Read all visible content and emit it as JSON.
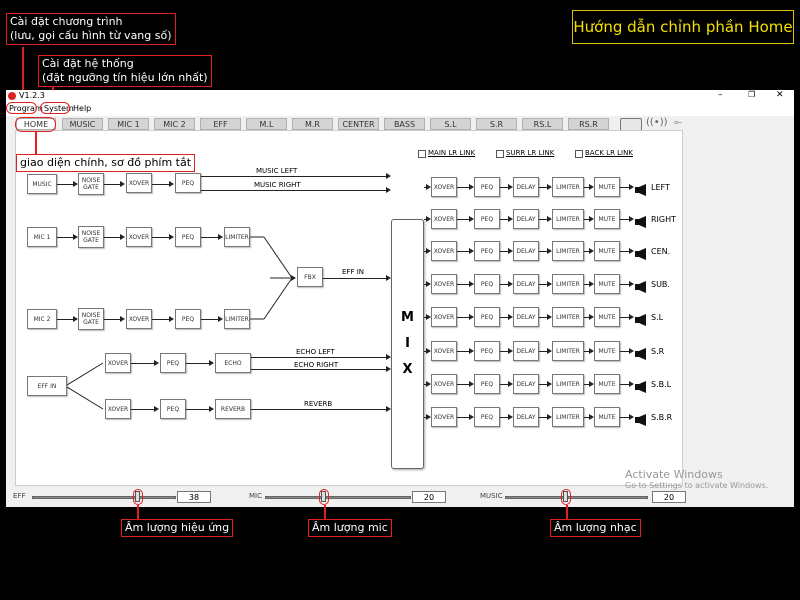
{
  "guide_title": "Hướng dẫn chỉnh phần Home",
  "annotations": {
    "program": [
      "Cài đặt chương trình",
      "(lưu, gọi cấu hình từ vang số)"
    ],
    "system": [
      "Cài đặt hệ thống",
      "(đặt ngưỡng tín hiệu lớn nhất)"
    ],
    "home": "giao diện chính, sơ đồ phím tắt",
    "eff_volume": "Âm lượng hiệu ứng",
    "mic_volume": "Âm lượng mic",
    "music_volume": "Âm lượng nhạc"
  },
  "window": {
    "version": "V1.2.3",
    "controls": [
      "–",
      "❐",
      "✕"
    ]
  },
  "menu": {
    "program": "Program",
    "system": "System",
    "help": "Help"
  },
  "tabs": [
    "HOME",
    "MUSIC",
    "MIC 1",
    "MIC 2",
    "EFF",
    "M.L",
    "M.R",
    "CENTER",
    "BASS",
    "S.L",
    "S.R",
    "RS.L",
    "RS.R"
  ],
  "links": {
    "main": "MAIN LR LINK",
    "surr": "SURR LR LINK",
    "back": "BACK LR LINK"
  },
  "inputs": {
    "music": {
      "source": "MUSIC",
      "chain": [
        "NOISE GATE",
        "XOVER",
        "PEQ"
      ],
      "out1": "MUSIC LEFT",
      "out2": "MUSIC RIGHT"
    },
    "mic1": {
      "source": "MIC 1",
      "chain": [
        "NOISE GATE",
        "XOVER",
        "PEQ",
        "LIMITER"
      ]
    },
    "mic2": {
      "source": "MIC 2",
      "chain": [
        "NOISE GATE",
        "XOVER",
        "PEQ",
        "LIMITER"
      ]
    },
    "fbx": "FBX",
    "eff_in_label": "EFF IN",
    "eff": {
      "source": "EFF IN",
      "chain1": [
        "XOVER",
        "PEQ",
        "ECHO"
      ],
      "chain2": [
        "XOVER",
        "PEQ",
        "REVERB"
      ],
      "out1": "ECHO LEFT",
      "out2": "ECHO RIGHT",
      "out3": "REVERB"
    }
  },
  "mix": [
    "M",
    "I",
    "X"
  ],
  "output_chain": [
    "XOVER",
    "PEQ",
    "DELAY",
    "LIMITER",
    "MUTE"
  ],
  "outputs": [
    "LEFT",
    "RIGHT",
    "CEN.",
    "SUB.",
    "S.L",
    "S.R",
    "S.B.L",
    "S.B.R"
  ],
  "sliders": {
    "eff": {
      "label": "EFF",
      "value": "38"
    },
    "mic": {
      "label": "MIC",
      "value": "20"
    },
    "music": {
      "label": "MUSIC",
      "value": "20"
    }
  },
  "watermark": [
    "Activate Windows",
    "Go to Settings to activate Windows."
  ],
  "colors": {
    "annotation": "#e02020",
    "guide_title": "#f4e000",
    "background": "#000000"
  }
}
